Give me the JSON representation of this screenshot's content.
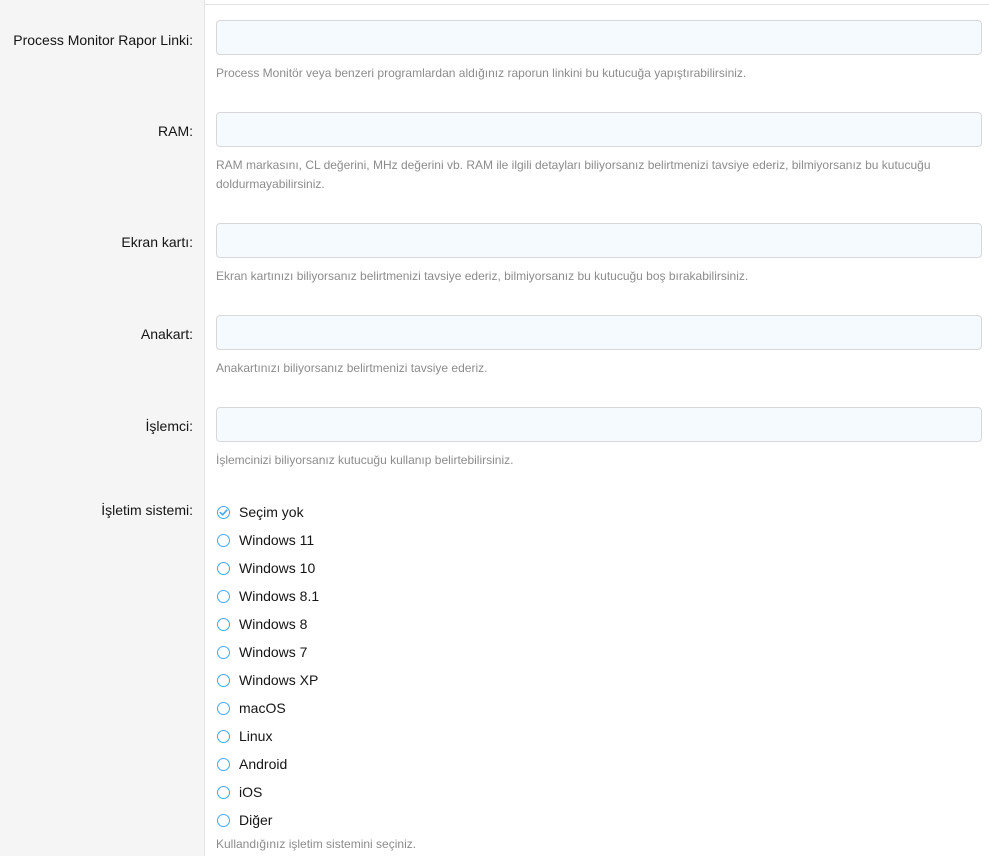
{
  "fields": {
    "process_monitor": {
      "label": "Process Monitor Rapor Linki:",
      "value": "",
      "hint": "Process Monitör veya benzeri programlardan aldığınız raporun linkini bu kutucuğa yapıştırabilirsiniz."
    },
    "ram": {
      "label": "RAM:",
      "value": "",
      "hint": "RAM markasını, CL değerini, MHz değerini vb. RAM ile ilgili detayları biliyorsanız belirtmenizi tavsiye ederiz, bilmiyorsanız bu kutucuğu doldurmayabilirsiniz."
    },
    "gpu": {
      "label": "Ekran kartı:",
      "value": "",
      "hint": "Ekran kartınızı biliyorsanız belirtmenizi tavsiye ederiz, bilmiyorsanız bu kutucuğu boş bırakabilirsiniz."
    },
    "motherboard": {
      "label": "Anakart:",
      "value": "",
      "hint": "Anakartınızı biliyorsanız belirtmenizi tavsiye ederiz."
    },
    "cpu": {
      "label": "İşlemci:",
      "value": "",
      "hint": "İşlemcinizi biliyorsanız kutucuğu kullanıp belirtebilirsiniz."
    }
  },
  "os": {
    "label": "İşletim sistemi:",
    "selected": "Seçim yok",
    "options": [
      "Seçim yok",
      "Windows 11",
      "Windows 10",
      "Windows 8.1",
      "Windows 8",
      "Windows 7",
      "Windows XP",
      "macOS",
      "Linux",
      "Android",
      "iOS",
      "Diğer"
    ],
    "hint": "Kullandığınız işletim sistemini seçiniz."
  },
  "colors": {
    "accent": "#47a7eb",
    "input_bg": "#f5fafe",
    "label_col_bg": "#f5f5f5",
    "hint_text": "#8c8c8c"
  }
}
